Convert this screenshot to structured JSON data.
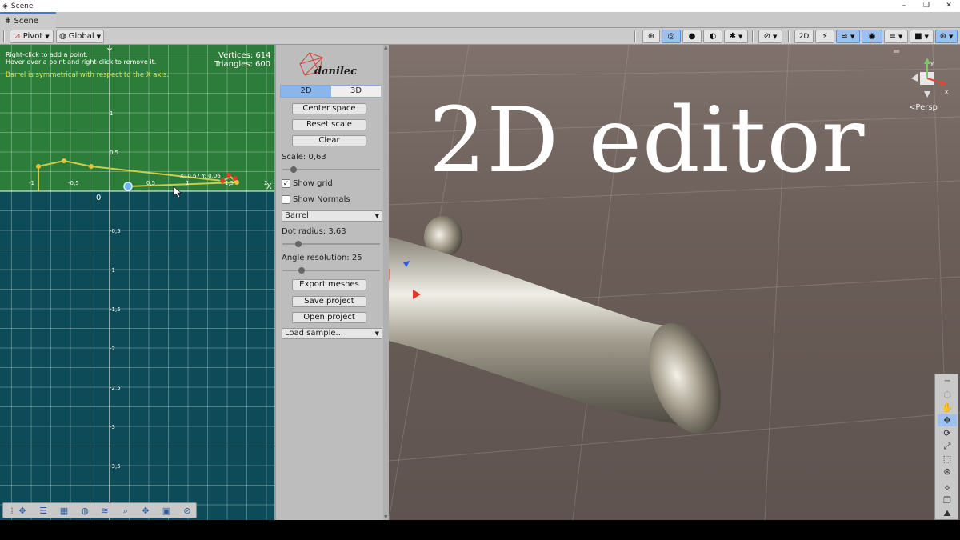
{
  "window": {
    "title": "Scene",
    "controls": [
      "–",
      "❐",
      "✕"
    ]
  },
  "tab": {
    "label": "Scene"
  },
  "toolbar": {
    "pivot": "Pivot",
    "global": "Global",
    "persp_label": "Persp"
  },
  "editor2d": {
    "hint_line1": "Right-click to add a point.",
    "hint_line2": "Hover over a point and right-click to remove it.",
    "symmetry": "Barrel is symmetrical with respect to the X axis.",
    "vertices": "Vertices: 614",
    "triangles": "Triangles: 600",
    "x_axis": "X",
    "y_axis": "Y",
    "origin": "0",
    "coord_readout": "X: 0.67 Y: 0.06",
    "x_ticks": [
      "-1",
      "-0,5",
      "0,5",
      "1",
      "1,5",
      "2"
    ],
    "y_ticks": [
      "1",
      "0,5",
      "-0,5",
      "-1",
      "-1,5",
      "-2",
      "-2,5",
      "-3",
      "-3,5"
    ],
    "colors": {
      "top_bg": "#2d7d3a",
      "bottom_bg": "#0d4b58",
      "curve": "#c7cf4a",
      "symmetry_text": "#d6e845"
    }
  },
  "panel": {
    "logo": "danilec",
    "tab_2d": "2D",
    "tab_3d": "3D",
    "center_space": "Center space",
    "reset_scale": "Reset scale",
    "clear": "Clear",
    "scale_label": "Scale: 0,63",
    "show_grid": "Show grid",
    "show_normals": "Show Normals",
    "shape_select": "Barrel",
    "dot_radius": "Dot radius: 3,63",
    "angle_resolution": "Angle resolution: 25",
    "export_meshes": "Export meshes",
    "save_project": "Save project",
    "open_project": "Open project",
    "load_sample": "Load sample..."
  },
  "view3d": {
    "overlay_title": "2D editor"
  }
}
